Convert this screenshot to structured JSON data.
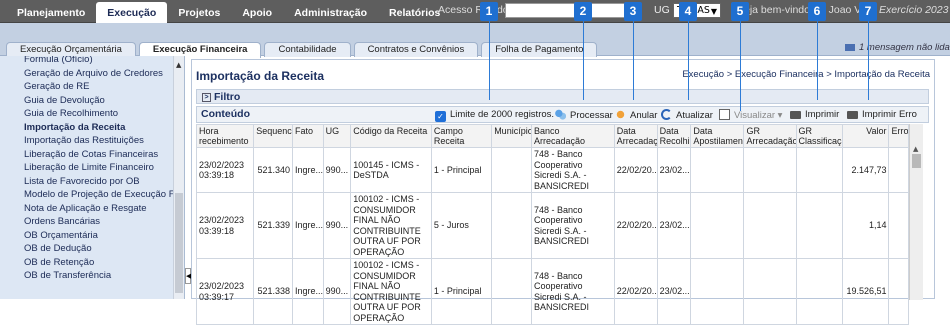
{
  "topnav": {
    "tabs": [
      "Planejamento",
      "Execução",
      "Projetos",
      "Apoio",
      "Administração",
      "Relatórios"
    ],
    "active": 1
  },
  "header": {
    "access_label": "Acesso Rápido",
    "ug_label": "UG",
    "ug_value": "TODAS",
    "welcome": "Seja bem-vindo(a), Joao Vitor",
    "year": "Exercício 2023"
  },
  "subtabs": {
    "tabs": [
      "Execução Orçamentária",
      "Execução Financeira",
      "Contabilidade",
      "Contratos e Convênios",
      "Folha de Pagamento"
    ],
    "active": 1
  },
  "messages": "1 mensagem não lida",
  "sidebar": {
    "items": [
      "Formula (Ofício)",
      "Geração de Arquivo de Credores",
      "Geração de RE",
      "Guia de Devolução",
      "Guia de Recolhimento",
      "Importação da Receita",
      "Importação das Restituições",
      "Liberação de Cotas Financeiras",
      "Liberação de Limite Financeiro",
      "Lista de Favorecido por OB",
      "Modelo de Projeção de Execução Financeira",
      "Nota de Aplicação e Resgate",
      "Ordens Bancárias",
      "OB Orçamentária",
      "OB de Dedução",
      "OB de Retenção",
      "OB de Transferência"
    ],
    "active": 5
  },
  "page": {
    "title": "Importação da Receita",
    "breadcrumb": "Execução > Execução Financeira > Importação da Receita",
    "filter_label": "Filtro",
    "content_label": "Conteúdo"
  },
  "toolbar": {
    "limit": "Limite de 2000 registros.",
    "processar": "Processar",
    "anular": "Anular",
    "atualizar": "Atualizar",
    "visualizar": "Visualizar",
    "imprimir": "Imprimir",
    "imprimir_erro": "Imprimir Erro"
  },
  "callouts": [
    "1",
    "2",
    "3",
    "4",
    "5",
    "6",
    "7"
  ],
  "table": {
    "headers": [
      "Hora recebimento",
      "Sequencial",
      "Fato",
      "UG",
      "Código da Receita",
      "Campo Receita",
      "Município",
      "Banco Arrecadação",
      "Data Arrecadação",
      "Data Recolhim.",
      "Data Apostilamento",
      "GR Arrecadação",
      "GR Classificação",
      "Valor",
      "Erro"
    ],
    "rows": [
      [
        "23/02/2023 03:39:18",
        "521.340",
        "Ingre...",
        "990...",
        "100145 - ICMS - DeSTDA",
        "1 - Principal",
        "",
        "748 - Banco Cooperativo Sicredi S.A. - BANSICREDI",
        "22/02/20...",
        "23/02...",
        "",
        "",
        "",
        "2.147,73",
        ""
      ],
      [
        "23/02/2023 03:39:18",
        "521.339",
        "Ingre...",
        "990...",
        "100102 - ICMS - CONSUMIDOR FINAL NÃO CONTRIBUINTE OUTRA UF POR OPERAÇÃO",
        "5 - Juros",
        "",
        "748 - Banco Cooperativo Sicredi S.A. - BANSICREDI",
        "22/02/20...",
        "23/02...",
        "",
        "",
        "",
        "1,14",
        ""
      ],
      [
        "23/02/2023 03:39:17",
        "521.338",
        "Ingre...",
        "990...",
        "100102 - ICMS - CONSUMIDOR FINAL NÃO CONTRIBUINTE OUTRA UF POR OPERAÇÃO",
        "1 - Principal",
        "",
        "748 - Banco Cooperativo Sicredi S.A. - BANSICREDI",
        "22/02/20...",
        "23/02...",
        "",
        "",
        "",
        "19.526,51",
        ""
      ]
    ]
  }
}
